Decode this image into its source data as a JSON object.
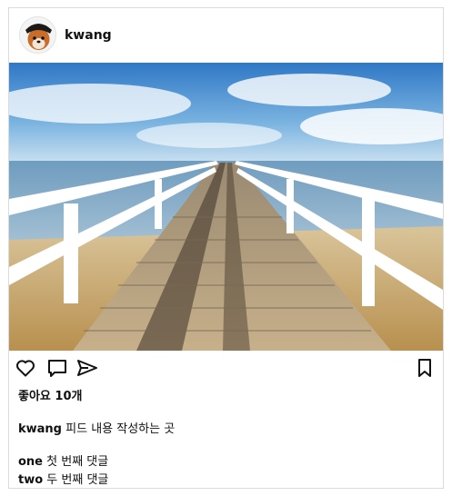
{
  "post": {
    "username": "kwang",
    "avatar_icon": "dog-avatar",
    "image_description_icon": "pier-photo",
    "likes_text": "좋아요 10개",
    "caption_user": "kwang",
    "caption_text": "피드 내용 작성하는 곳",
    "comments": [
      {
        "user": "one",
        "text": "첫 번째 댓글"
      },
      {
        "user": "two",
        "text": "두 번째 댓글"
      }
    ]
  },
  "actions": {
    "like_icon": "heart-icon",
    "comment_icon": "comment-icon",
    "share_icon": "send-icon",
    "bookmark_icon": "bookmark-icon"
  },
  "colors": {
    "border": "#dbdbdb",
    "text": "#111111",
    "sky": "#4a8fd0",
    "sea": "#7fa7c4",
    "sand": "#c8a56c"
  }
}
